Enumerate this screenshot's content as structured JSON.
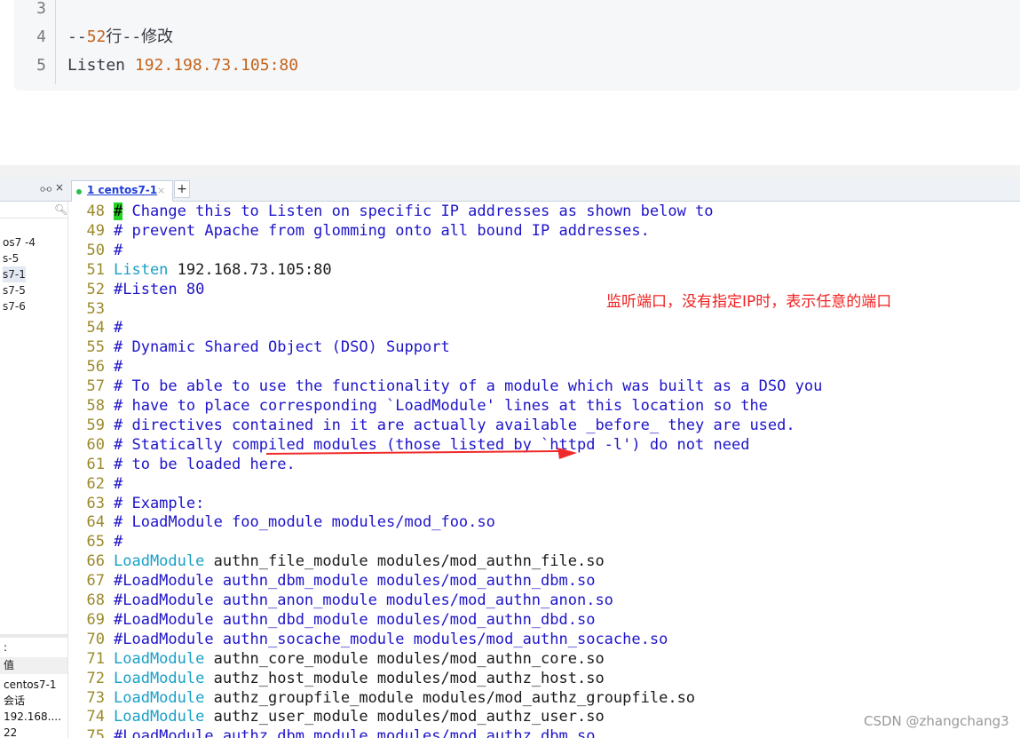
{
  "snippet": {
    "line3": {
      "num": "3"
    },
    "line4": {
      "num": "4",
      "prefix": "--",
      "num_text": "52",
      "suffix": "行--修改"
    },
    "line5": {
      "num": "5",
      "keyword": "Listen ",
      "value": "192.198.73.105:80"
    }
  },
  "tabstrip": {
    "pin_icon": "pin-icon",
    "close_icon": "×",
    "tab_label": "1 centos7-1",
    "tab_close": "×",
    "add": "+"
  },
  "sidebar": {
    "items": [
      "os7 -4",
      "s-5",
      "s7-1",
      "s7-5",
      "s7-6"
    ],
    "props": [
      ":",
      "值",
      "centos7-1",
      "会话",
      "192.168....",
      "22"
    ]
  },
  "code_lines": [
    {
      "n": "48",
      "t": "# Change this to Listen on specific IP addresses as shown below to"
    },
    {
      "n": "49",
      "t": "# prevent Apache from glomming onto all bound IP addresses."
    },
    {
      "n": "50",
      "t": "#"
    },
    {
      "n": "51",
      "kw": "Listen",
      "t": " 192.168.73.105:80"
    },
    {
      "n": "52",
      "t": "#Listen 80"
    },
    {
      "n": "53",
      "t": ""
    },
    {
      "n": "54",
      "t": "#"
    },
    {
      "n": "55",
      "t": "# Dynamic Shared Object (DSO) Support"
    },
    {
      "n": "56",
      "t": "#"
    },
    {
      "n": "57",
      "t": "# To be able to use the functionality of a module which was built as a DSO you"
    },
    {
      "n": "58",
      "t": "# have to place corresponding `LoadModule' lines at this location so the"
    },
    {
      "n": "59",
      "t": "# directives contained in it are actually available _before_ they are used."
    },
    {
      "n": "60",
      "t": "# Statically compiled modules (those listed by `httpd -l') do not need"
    },
    {
      "n": "61",
      "t": "# to be loaded here."
    },
    {
      "n": "62",
      "t": "#"
    },
    {
      "n": "63",
      "t": "# Example:"
    },
    {
      "n": "64",
      "t": "# LoadModule foo_module modules/mod_foo.so"
    },
    {
      "n": "65",
      "t": "#"
    },
    {
      "n": "66",
      "kw": "LoadModule",
      "t": " authn_file_module modules/mod_authn_file.so"
    },
    {
      "n": "67",
      "t": "#LoadModule authn_dbm_module modules/mod_authn_dbm.so"
    },
    {
      "n": "68",
      "t": "#LoadModule authn_anon_module modules/mod_authn_anon.so"
    },
    {
      "n": "69",
      "t": "#LoadModule authn_dbd_module modules/mod_authn_dbd.so"
    },
    {
      "n": "70",
      "t": "#LoadModule authn_socache_module modules/mod_authn_socache.so"
    },
    {
      "n": "71",
      "kw": "LoadModule",
      "t": " authn_core_module modules/mod_authn_core.so"
    },
    {
      "n": "72",
      "kw": "LoadModule",
      "t": " authz_host_module modules/mod_authz_host.so"
    },
    {
      "n": "73",
      "kw": "LoadModule",
      "t": " authz_groupfile_module modules/mod_authz_groupfile.so"
    },
    {
      "n": "74",
      "kw": "LoadModule",
      "t": " authz_user_module modules/mod_authz_user.so"
    },
    {
      "n": "75",
      "t": "#LoadModule authz_dbm_module modules/mod_authz_dbm.so"
    }
  ],
  "annotation": "监听端口，没有指定IP时，表示任意的端口",
  "watermark": "CSDN @zhangchang3",
  "colors": {
    "comment": "#1e14c8",
    "keyword": "#1aa0c8",
    "line_number": "#9b8a2a",
    "annotation": "#f02020"
  }
}
